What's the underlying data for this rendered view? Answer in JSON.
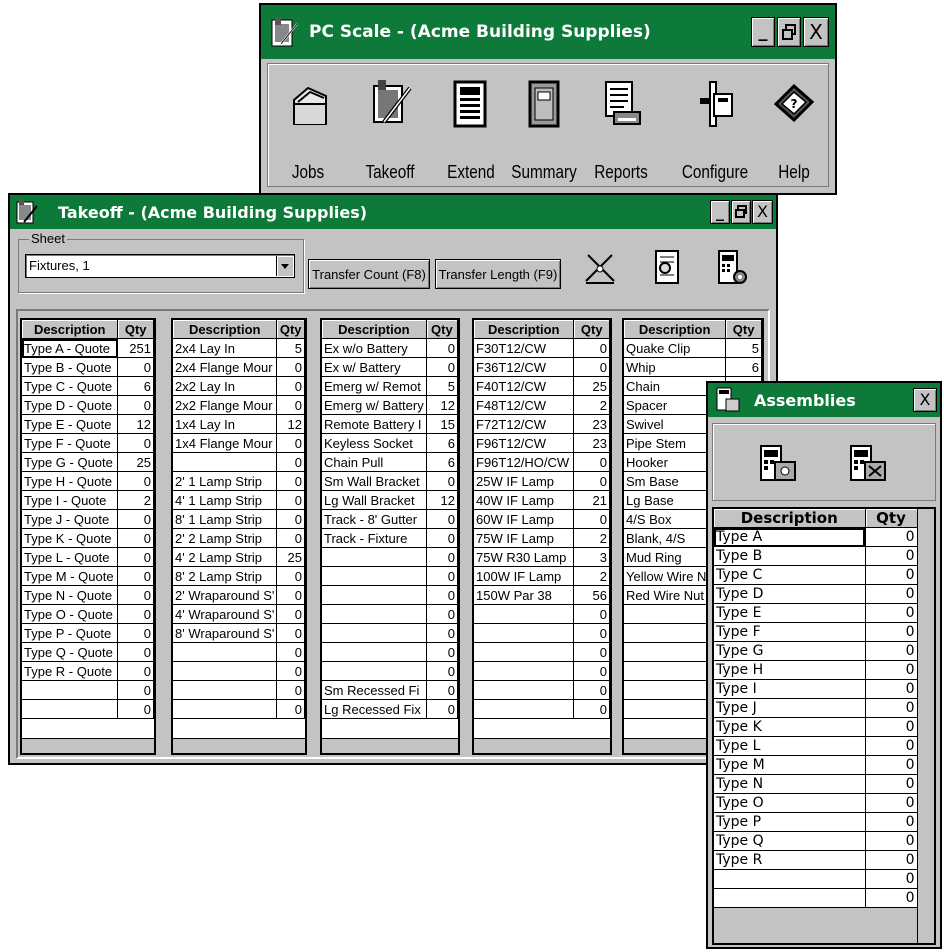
{
  "main_window": {
    "title": "PC Scale - (Acme Building Supplies)",
    "toolbar": [
      {
        "label": "Jobs",
        "icon": "folder-icon"
      },
      {
        "label": "Takeoff",
        "icon": "takeoff-pen-icon"
      },
      {
        "label": "Extend",
        "icon": "extend-calculator-icon"
      },
      {
        "label": "Summary",
        "icon": "summary-notebook-icon"
      },
      {
        "label": "Reports",
        "icon": "report-printer-icon"
      },
      {
        "label": "Configure",
        "icon": "configure-tools-icon"
      },
      {
        "label": "Help",
        "icon": "help-book-icon"
      }
    ]
  },
  "takeoff_window": {
    "title": "Takeoff - (Acme Building Supplies)",
    "sheet_label": "Sheet",
    "sheet_value": "Fixtures, 1",
    "transfer_count_label": "Transfer Count (F8)",
    "transfer_length_label": "Transfer Length (F9)",
    "col_header_desc": "Description",
    "col_header_qty": "Qty",
    "grids": [
      [
        [
          "Type A - Quote",
          "251"
        ],
        [
          "Type B - Quote",
          "0"
        ],
        [
          "Type C - Quote",
          "6"
        ],
        [
          "Type D - Quote",
          "0"
        ],
        [
          "Type E - Quote",
          "12"
        ],
        [
          "Type F - Quote",
          "0"
        ],
        [
          "Type G - Quote",
          "25"
        ],
        [
          "Type H - Quote",
          "0"
        ],
        [
          "Type I - Quote",
          "2"
        ],
        [
          "Type J - Quote",
          "0"
        ],
        [
          "Type K - Quote",
          "0"
        ],
        [
          "Type L - Quote",
          "0"
        ],
        [
          "Type M - Quote",
          "0"
        ],
        [
          "Type N - Quote",
          "0"
        ],
        [
          "Type O - Quote",
          "0"
        ],
        [
          "Type P - Quote",
          "0"
        ],
        [
          "Type Q - Quote",
          "0"
        ],
        [
          "Type R - Quote",
          "0"
        ],
        [
          "",
          "0"
        ],
        [
          "",
          "0"
        ]
      ],
      [
        [
          "2x4 Lay In",
          "5"
        ],
        [
          "2x4 Flange Mour",
          "0"
        ],
        [
          "2x2 Lay In",
          "0"
        ],
        [
          "2x2 Flange Mour",
          "0"
        ],
        [
          "1x4 Lay In",
          "12"
        ],
        [
          "1x4 Flange Mour",
          "0"
        ],
        [
          "",
          "0"
        ],
        [
          "2' 1 Lamp Strip",
          "0"
        ],
        [
          "4' 1 Lamp Strip",
          "0"
        ],
        [
          "8' 1 Lamp Strip",
          "0"
        ],
        [
          "2' 2 Lamp Strip",
          "0"
        ],
        [
          "4' 2 Lamp Strip",
          "25"
        ],
        [
          "8' 2 Lamp Strip",
          "0"
        ],
        [
          "2' Wraparound S'",
          "0"
        ],
        [
          "4' Wraparound S'",
          "0"
        ],
        [
          "8' Wraparound S'",
          "0"
        ],
        [
          "",
          "0"
        ],
        [
          "",
          "0"
        ],
        [
          "",
          "0"
        ],
        [
          "",
          "0"
        ]
      ],
      [
        [
          "Ex w/o Battery",
          "0"
        ],
        [
          "Ex w/ Battery",
          "0"
        ],
        [
          "Emerg w/ Remot",
          "5"
        ],
        [
          "Emerg w/ Battery",
          "12"
        ],
        [
          "Remote Battery I",
          "15"
        ],
        [
          "Keyless Socket",
          "6"
        ],
        [
          "Chain Pull",
          "6"
        ],
        [
          "Sm Wall Bracket",
          "0"
        ],
        [
          "Lg Wall Bracket",
          "12"
        ],
        [
          "Track - 8' Gutter",
          "0"
        ],
        [
          "Track - Fixture",
          "0"
        ],
        [
          "",
          "0"
        ],
        [
          "",
          "0"
        ],
        [
          "",
          "0"
        ],
        [
          "",
          "0"
        ],
        [
          "",
          "0"
        ],
        [
          "",
          "0"
        ],
        [
          "",
          "0"
        ],
        [
          "Sm Recessed Fi",
          "0"
        ],
        [
          "Lg Recessed Fix",
          "0"
        ]
      ],
      [
        [
          "F30T12/CW",
          "0"
        ],
        [
          "F36T12/CW",
          "0"
        ],
        [
          "F40T12/CW",
          "25"
        ],
        [
          "F48T12/CW",
          "2"
        ],
        [
          "F72T12/CW",
          "23"
        ],
        [
          "F96T12/CW",
          "23"
        ],
        [
          "F96T12/HO/CW",
          "0"
        ],
        [
          " 25W IF Lamp",
          "0"
        ],
        [
          " 40W IF Lamp",
          "21"
        ],
        [
          " 60W IF Lamp",
          "0"
        ],
        [
          " 75W IF Lamp",
          "2"
        ],
        [
          " 75W R30 Lamp",
          "3"
        ],
        [
          "100W IF Lamp",
          "2"
        ],
        [
          "150W Par 38",
          "56"
        ],
        [
          "",
          "0"
        ],
        [
          "",
          "0"
        ],
        [
          "",
          "0"
        ],
        [
          "",
          "0"
        ],
        [
          "",
          "0"
        ],
        [
          "",
          "0"
        ]
      ],
      [
        [
          "Quake Clip",
          "5"
        ],
        [
          "Whip",
          "6"
        ],
        [
          "Chain",
          ""
        ],
        [
          "Spacer",
          ""
        ],
        [
          "Swivel",
          ""
        ],
        [
          "Pipe Stem",
          ""
        ],
        [
          "Hooker",
          ""
        ],
        [
          "Sm Base",
          ""
        ],
        [
          "Lg Base",
          ""
        ],
        [
          "4/S Box",
          ""
        ],
        [
          "Blank, 4/S",
          ""
        ],
        [
          "Mud Ring",
          ""
        ],
        [
          "Yellow Wire Nu",
          ""
        ],
        [
          "Red Wire Nut",
          ""
        ],
        [
          "",
          ""
        ],
        [
          "",
          ""
        ],
        [
          "",
          ""
        ],
        [
          "",
          ""
        ],
        [
          "",
          ""
        ],
        [
          "",
          ""
        ]
      ]
    ]
  },
  "assemblies_window": {
    "title": "Assemblies",
    "col_header_desc": "Description",
    "col_header_qty": "Qty",
    "rows": [
      [
        "Type A",
        "0"
      ],
      [
        "Type B",
        "0"
      ],
      [
        "Type C",
        "0"
      ],
      [
        "Type D",
        "0"
      ],
      [
        "Type E",
        "0"
      ],
      [
        "Type F",
        "0"
      ],
      [
        "Type G",
        "0"
      ],
      [
        "Type H",
        "0"
      ],
      [
        "Type I",
        "0"
      ],
      [
        "Type J",
        "0"
      ],
      [
        "Type K",
        "0"
      ],
      [
        "Type L",
        "0"
      ],
      [
        "Type M",
        "0"
      ],
      [
        "Type N",
        "0"
      ],
      [
        "Type O",
        "0"
      ],
      [
        "Type P",
        "0"
      ],
      [
        "Type Q",
        "0"
      ],
      [
        "Type R",
        "0"
      ],
      [
        "",
        "0"
      ],
      [
        "",
        "0"
      ]
    ]
  },
  "window_controls": {
    "minimize": "_",
    "restore": "⧉",
    "close": "X"
  },
  "colors": {
    "titlebar": "#0d7a3a",
    "chrome": "#c3c3c3"
  }
}
